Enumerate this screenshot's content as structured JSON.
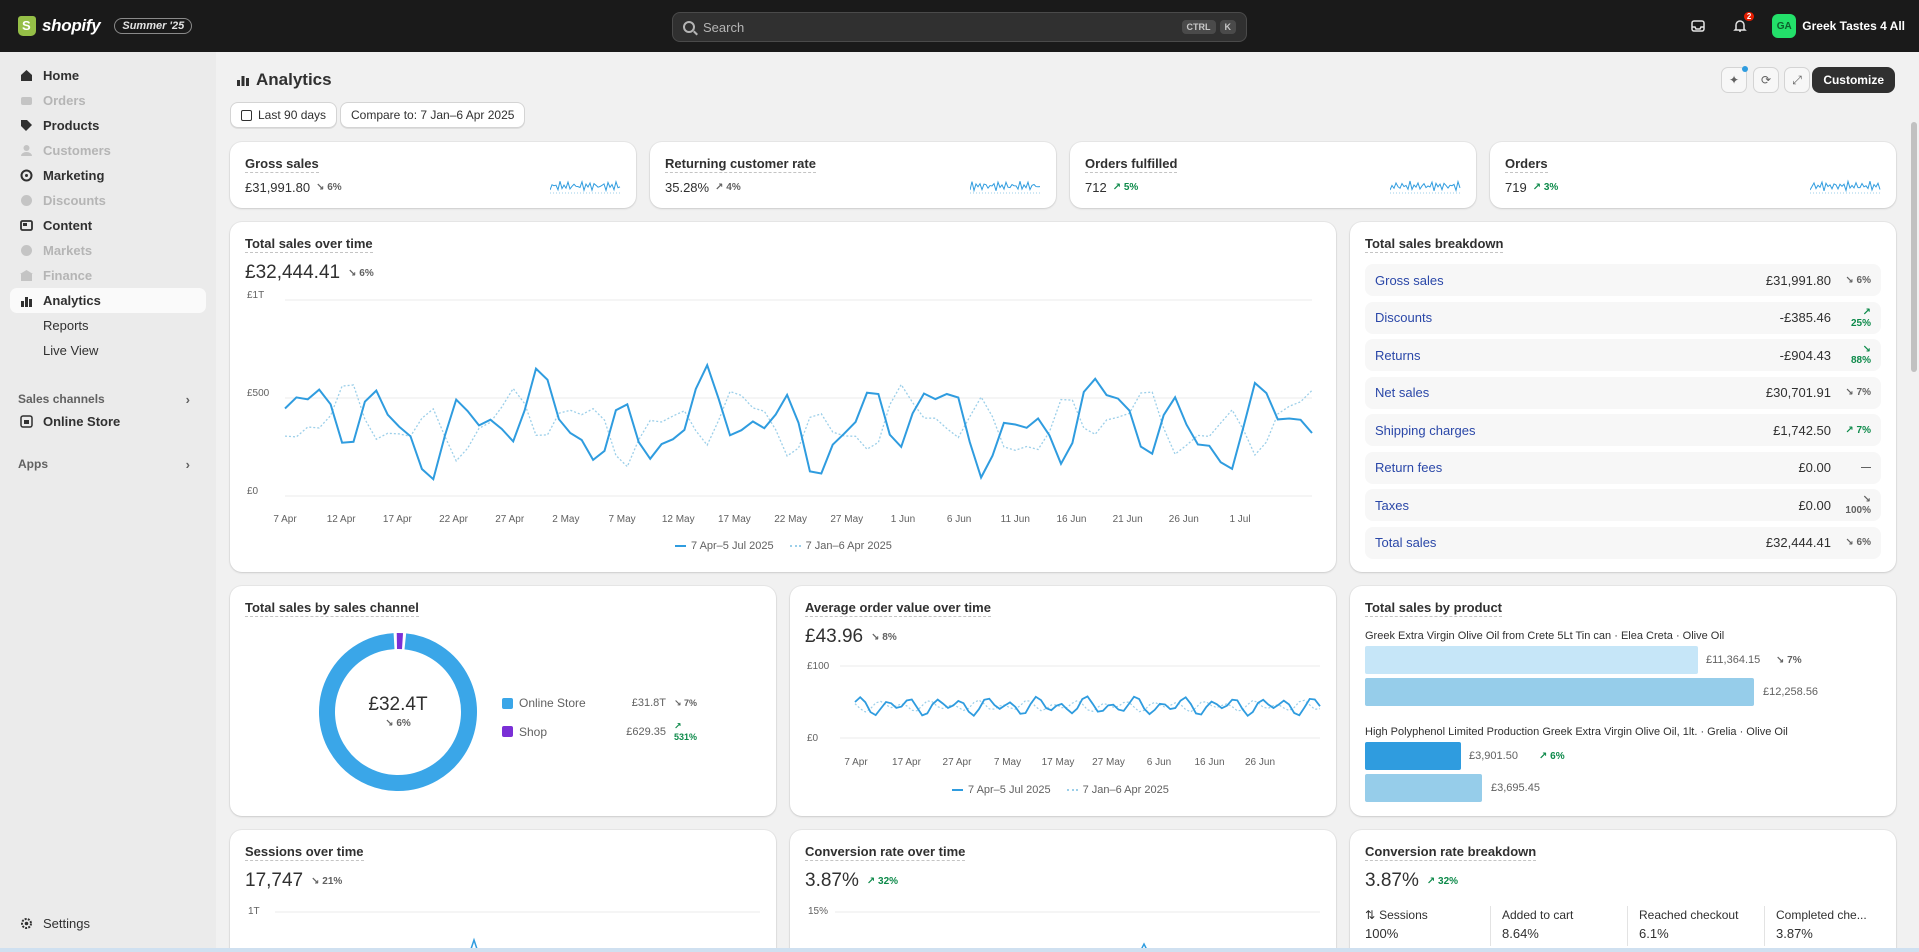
{
  "topbar": {
    "logo_text": "shopify",
    "edition_badge": "Summer '25",
    "search_placeholder": "Search",
    "shortcut_key1": "CTRL",
    "shortcut_key2": "K",
    "notification_count": "2",
    "store_initials": "GA",
    "store_name": "Greek Tastes 4 All"
  },
  "sidebar": {
    "items": [
      {
        "label": "Home",
        "icon": "home-icon",
        "disabled": false
      },
      {
        "label": "Orders",
        "icon": "orders-icon",
        "disabled": true
      },
      {
        "label": "Products",
        "icon": "tag-icon",
        "disabled": false
      },
      {
        "label": "Customers",
        "icon": "person-icon",
        "disabled": true
      },
      {
        "label": "Marketing",
        "icon": "target-icon",
        "disabled": false
      },
      {
        "label": "Discounts",
        "icon": "discount-icon",
        "disabled": true
      },
      {
        "label": "Content",
        "icon": "content-icon",
        "disabled": false
      },
      {
        "label": "Markets",
        "icon": "globe-icon",
        "disabled": true
      },
      {
        "label": "Finance",
        "icon": "bank-icon",
        "disabled": true
      },
      {
        "label": "Analytics",
        "icon": "chart-icon",
        "disabled": false
      }
    ],
    "analytics_sub": [
      "Reports",
      "Live View"
    ],
    "sales_channels_label": "Sales channels",
    "online_store_label": "Online Store",
    "apps_label": "Apps",
    "settings_label": "Settings"
  },
  "page": {
    "title": "Analytics",
    "date_range": "Last 90 days",
    "compare": "Compare to: 7 Jan–6 Apr 2025",
    "customize_label": "Customize"
  },
  "kpis": [
    {
      "title": "Gross sales",
      "value": "£31,991.80",
      "delta": "↘ 6%",
      "dir": "down"
    },
    {
      "title": "Returning customer rate",
      "value": "35.28%",
      "delta": "↗ 4%",
      "dir": "neutral"
    },
    {
      "title": "Orders fulfilled",
      "value": "712",
      "delta": "↗ 5%",
      "dir": "up"
    },
    {
      "title": "Orders",
      "value": "719",
      "delta": "↗ 3%",
      "dir": "up"
    }
  ],
  "total_sales": {
    "title": "Total sales over time",
    "value": "£32,444.41",
    "delta": "↘ 6%",
    "y_ticks": [
      "£1T",
      "£500",
      "£0"
    ],
    "x_ticks": [
      "7 Apr",
      "12 Apr",
      "17 Apr",
      "22 Apr",
      "27 Apr",
      "2 May",
      "7 May",
      "12 May",
      "17 May",
      "22 May",
      "27 May",
      "1 Jun",
      "6 Jun",
      "11 Jun",
      "16 Jun",
      "21 Jun",
      "26 Jun",
      "1 Jul"
    ],
    "legend_current": "7 Apr–5 Jul 2025",
    "legend_previous": "7 Jan–6 Apr 2025"
  },
  "breakdown": {
    "title": "Total sales breakdown",
    "rows": [
      {
        "label": "Gross sales",
        "value": "£31,991.80",
        "delta": "↘ 6%",
        "dir": "down"
      },
      {
        "label": "Discounts",
        "value": "-£385.46",
        "delta": "↗ 25%",
        "dir": "up"
      },
      {
        "label": "Returns",
        "value": "-£904.43",
        "delta": "↘ 88%",
        "dir": "up"
      },
      {
        "label": "Net sales",
        "value": "£30,701.91",
        "delta": "↘ 7%",
        "dir": "down"
      },
      {
        "label": "Shipping charges",
        "value": "£1,742.50",
        "delta": "↗ 7%",
        "dir": "up"
      },
      {
        "label": "Return fees",
        "value": "£0.00",
        "delta": "—",
        "dir": "down"
      },
      {
        "label": "Taxes",
        "value": "£0.00",
        "delta": "↘ 100%",
        "dir": "down"
      },
      {
        "label": "Total sales",
        "value": "£32,444.41",
        "delta": "↘ 6%",
        "dir": "down"
      }
    ]
  },
  "channel": {
    "title": "Total sales by sales channel",
    "center_value": "£32.4T",
    "center_delta": "↘ 6%",
    "items": [
      {
        "name": "Online Store",
        "value": "£31.8T",
        "delta": "↘ 7%",
        "dir": "down",
        "color": "#3aa6e8",
        "share": 0.981
      },
      {
        "name": "Shop",
        "value": "£629.35",
        "delta": "↗ 531%",
        "dir": "up",
        "color": "#7a2fd6",
        "share": 0.019
      }
    ]
  },
  "aov": {
    "title": "Average order value over time",
    "value": "£43.96",
    "delta": "↘ 8%",
    "y_ticks": [
      "£100",
      "£0"
    ],
    "x_ticks": [
      "7 Apr",
      "17 Apr",
      "27 Apr",
      "7 May",
      "17 May",
      "27 May",
      "6 Jun",
      "16 Jun",
      "26 Jun"
    ],
    "legend_current": "7 Apr–5 Jul 2025",
    "legend_previous": "7 Jan–6 Apr 2025"
  },
  "by_product": {
    "title": "Total sales by product",
    "products": [
      {
        "name": "Greek Extra Virgin Olive Oil from Crete 5Lt Tin can · Elea Creta · Olive Oil",
        "current": "£11,364.15",
        "previous": "£12,258.56",
        "delta": "↘ 7%",
        "dir": "down",
        "cur_val": 11364.15,
        "prev_val": 12258.56
      },
      {
        "name": "High Polyphenol Limited Production Greek Extra Virgin Olive Oil, 1lt. · Grelia · Olive Oil",
        "current": "£3,901.50",
        "previous": "£3,695.45",
        "delta": "↗ 6%",
        "dir": "up",
        "cur_val": 3901.5,
        "prev_val": 3695.45
      }
    ]
  },
  "sessions": {
    "title": "Sessions over time",
    "value": "17,747",
    "delta": "↘ 21%",
    "y_tick": "1T"
  },
  "conversion": {
    "title": "Conversion rate over time",
    "value": "3.87%",
    "delta": "↗ 32%",
    "y_tick": "15%"
  },
  "conv_breakdown": {
    "title": "Conversion rate breakdown",
    "value": "3.87%",
    "delta": "↗ 32%",
    "cols": [
      {
        "label": "Sessions",
        "value": "100%"
      },
      {
        "label": "Added to cart",
        "value": "8.64%"
      },
      {
        "label": "Reached checkout",
        "value": "6.1%"
      },
      {
        "label": "Completed che...",
        "value": "3.87%"
      }
    ]
  },
  "colors": {
    "accent": "#2f9cdf",
    "previous": "#9ccfe9",
    "up": "#0d8a4a"
  }
}
